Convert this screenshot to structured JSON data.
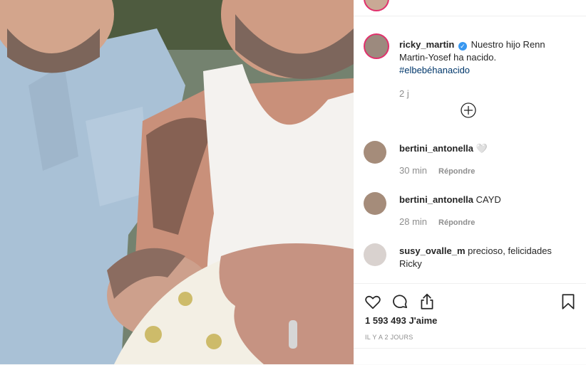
{
  "post": {
    "author": "ricky_martin",
    "caption": "Nuestro hijo Renn Martin-Yosef ha nacido.",
    "hashtag": "#elbebéhanacido",
    "age": "2 j"
  },
  "comments": [
    {
      "user": "bertini_antonella",
      "text": "🤍",
      "time": "30 min",
      "reply": "Répondre"
    },
    {
      "user": "bertini_antonella",
      "text": "CAYD",
      "time": "28 min",
      "reply": "Répondre"
    },
    {
      "user": "susy_ovalle_m",
      "text": "precioso, felicidades Ricky"
    }
  ],
  "footer": {
    "likes": "1 593 493 J'aime",
    "date": "IL Y A 2 JOURS"
  },
  "icons": [
    "verified-badge-icon",
    "load-more-icon",
    "heart-icon",
    "comment-icon",
    "share-icon",
    "bookmark-icon"
  ],
  "colors": {
    "accent": "#3897f0",
    "hashtag": "#00376b",
    "muted": "#8e8e8e"
  }
}
